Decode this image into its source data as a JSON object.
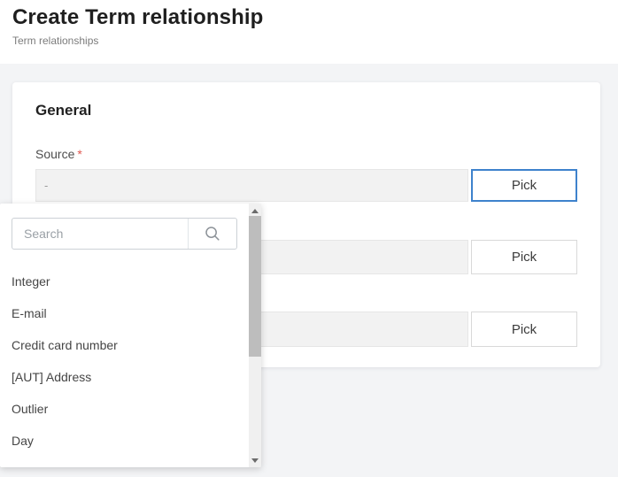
{
  "page": {
    "title": "Create Term relationship",
    "breadcrumb": "Term relationships"
  },
  "form": {
    "section_title": "General",
    "required_marker": "*",
    "fields": [
      {
        "label": "Source",
        "value": "-",
        "button": "Pick"
      },
      {
        "label": "",
        "value": "",
        "button": "Pick"
      },
      {
        "label": "",
        "value": "",
        "button": "Pick"
      }
    ]
  },
  "dropdown": {
    "search_placeholder": "Search",
    "search_value": "",
    "items": [
      "Integer",
      "E-mail",
      "Credit card number",
      "[AUT] Address",
      "Outlier",
      "Day"
    ]
  },
  "icons": {
    "search": "magnifier",
    "scroll_up": "triangle-up",
    "scroll_down": "triangle-down"
  },
  "colors": {
    "accent_blue": "#3e82cc",
    "required_red": "#e0574f",
    "page_bg": "#f3f4f6",
    "field_bg": "#f2f2f2"
  }
}
